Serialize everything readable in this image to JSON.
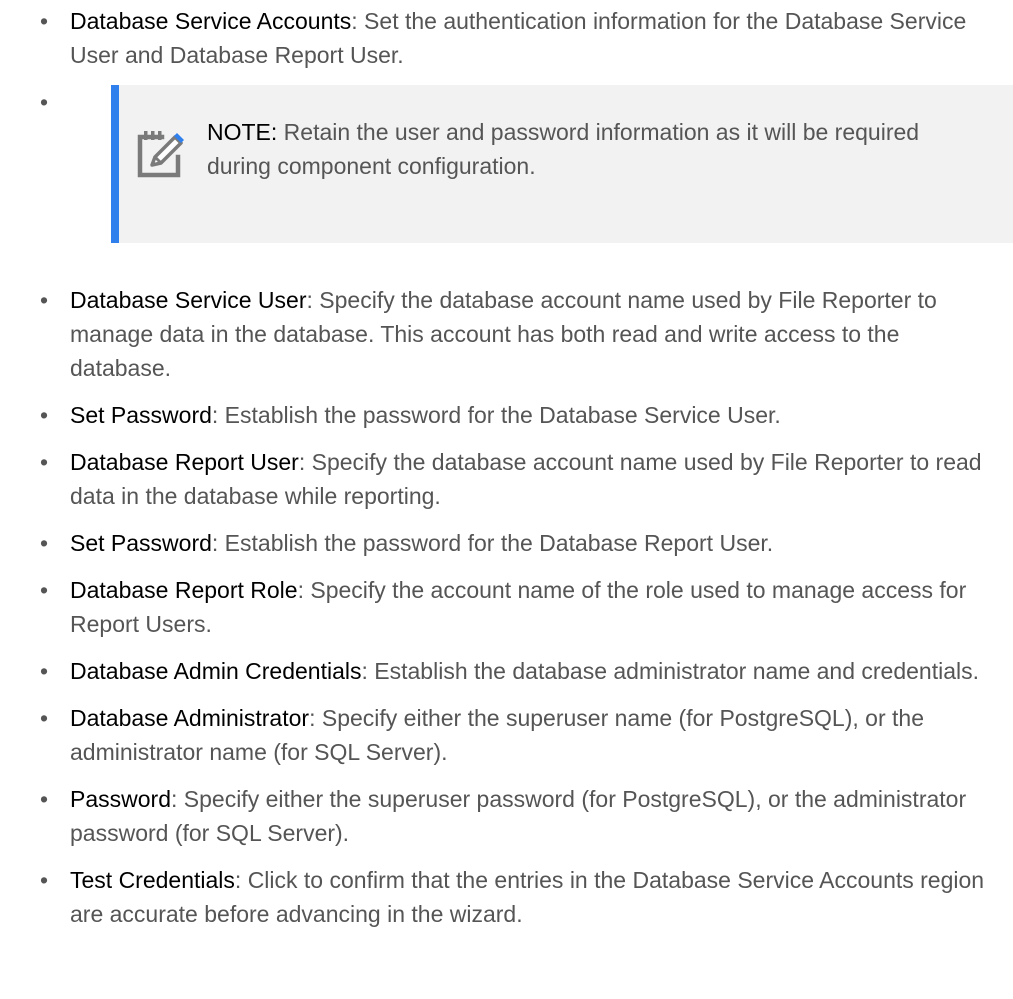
{
  "bullet": "•",
  "accent_color": "#2f80ed",
  "note_background": "#f2f2f2",
  "note_icon": "note-edit-icon",
  "items": [
    {
      "term": "Database Service Accounts",
      "desc": ": Set the authentication information for the Database Service User and Database Report User."
    },
    {
      "term": "Database Service User",
      "desc": ": Specify the database account name used by File Reporter to manage data in the database. This account has both read and write access to the database."
    },
    {
      "term": "Set Password",
      "desc": ": Establish the password for the Database Service User."
    },
    {
      "term": "Database Report User",
      "desc": ": Specify the database account name used by File Reporter to read data in the database while reporting."
    },
    {
      "term": "Set Password",
      "desc": ": Establish the password for the Database Report User."
    },
    {
      "term": "Database Report Role",
      "desc": ": Specify the account name of the role used to manage access for Report Users."
    },
    {
      "term": "Database Admin Credentials",
      "desc": ": Establish the database administrator name and credentials."
    },
    {
      "term": "Database Administrator",
      "desc": ": Specify either the superuser name (for PostgreSQL), or the administrator name (for SQL Server)."
    },
    {
      "term": "Password",
      "desc": ": Specify either the superuser password (for PostgreSQL), or the administrator password (for SQL Server)."
    },
    {
      "term": "Test Credentials",
      "desc": ": Click to confirm that the entries in the Database Service Accounts region are accurate before advancing in the wizard."
    }
  ],
  "note": {
    "label": "NOTE:",
    "text": " Retain the user and password information as it will be required during component configuration."
  }
}
